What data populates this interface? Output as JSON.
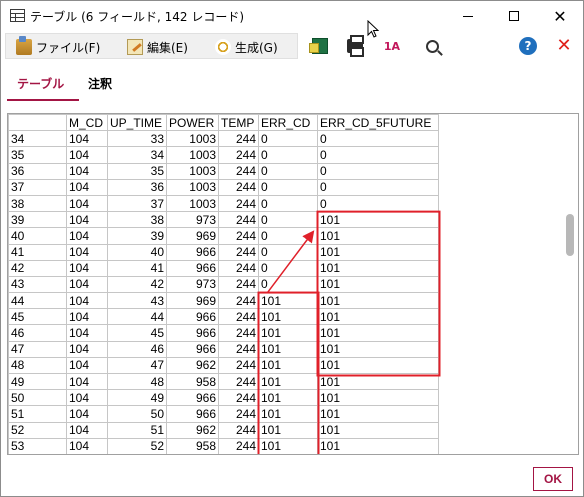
{
  "window": {
    "title": "テーブル (6 フィールド, 142 レコード)"
  },
  "menu": {
    "file": "ファイル(F)",
    "edit": "編集(E)",
    "generate": "生成(G)"
  },
  "toolbar": {
    "sort_label": "1A",
    "help_glyph": "?",
    "close_glyph": "✕"
  },
  "tabs": [
    {
      "label": "テーブル",
      "active": true
    },
    {
      "label": "注釈",
      "active": false
    }
  ],
  "accent_color": "#a31544",
  "highlight_color": "#e0202a",
  "table": {
    "columns": [
      "",
      "M_CD",
      "UP_TIME",
      "POWER",
      "TEMP",
      "ERR_CD",
      "ERR_CD_5FUTURE"
    ],
    "rows": [
      [
        "34",
        "104",
        "33",
        "1003",
        "244",
        "0",
        "0"
      ],
      [
        "35",
        "104",
        "34",
        "1003",
        "244",
        "0",
        "0"
      ],
      [
        "36",
        "104",
        "35",
        "1003",
        "244",
        "0",
        "0"
      ],
      [
        "37",
        "104",
        "36",
        "1003",
        "244",
        "0",
        "0"
      ],
      [
        "38",
        "104",
        "37",
        "1003",
        "244",
        "0",
        "0"
      ],
      [
        "39",
        "104",
        "38",
        "973",
        "244",
        "0",
        "101"
      ],
      [
        "40",
        "104",
        "39",
        "969",
        "244",
        "0",
        "101"
      ],
      [
        "41",
        "104",
        "40",
        "966",
        "244",
        "0",
        "101"
      ],
      [
        "42",
        "104",
        "41",
        "966",
        "244",
        "0",
        "101"
      ],
      [
        "43",
        "104",
        "42",
        "973",
        "244",
        "0",
        "101"
      ],
      [
        "44",
        "104",
        "43",
        "969",
        "244",
        "101",
        "101"
      ],
      [
        "45",
        "104",
        "44",
        "966",
        "244",
        "101",
        "101"
      ],
      [
        "46",
        "104",
        "45",
        "966",
        "244",
        "101",
        "101"
      ],
      [
        "47",
        "104",
        "46",
        "966",
        "244",
        "101",
        "101"
      ],
      [
        "48",
        "104",
        "47",
        "962",
        "244",
        "101",
        "101"
      ],
      [
        "49",
        "104",
        "48",
        "958",
        "244",
        "101",
        "101"
      ],
      [
        "50",
        "104",
        "49",
        "966",
        "244",
        "101",
        "101"
      ],
      [
        "51",
        "104",
        "50",
        "966",
        "244",
        "101",
        "101"
      ],
      [
        "52",
        "104",
        "51",
        "962",
        "244",
        "101",
        "101"
      ],
      [
        "53",
        "104",
        "52",
        "958",
        "244",
        "101",
        "101"
      ]
    ]
  },
  "footer": {
    "ok_label": "OK"
  }
}
